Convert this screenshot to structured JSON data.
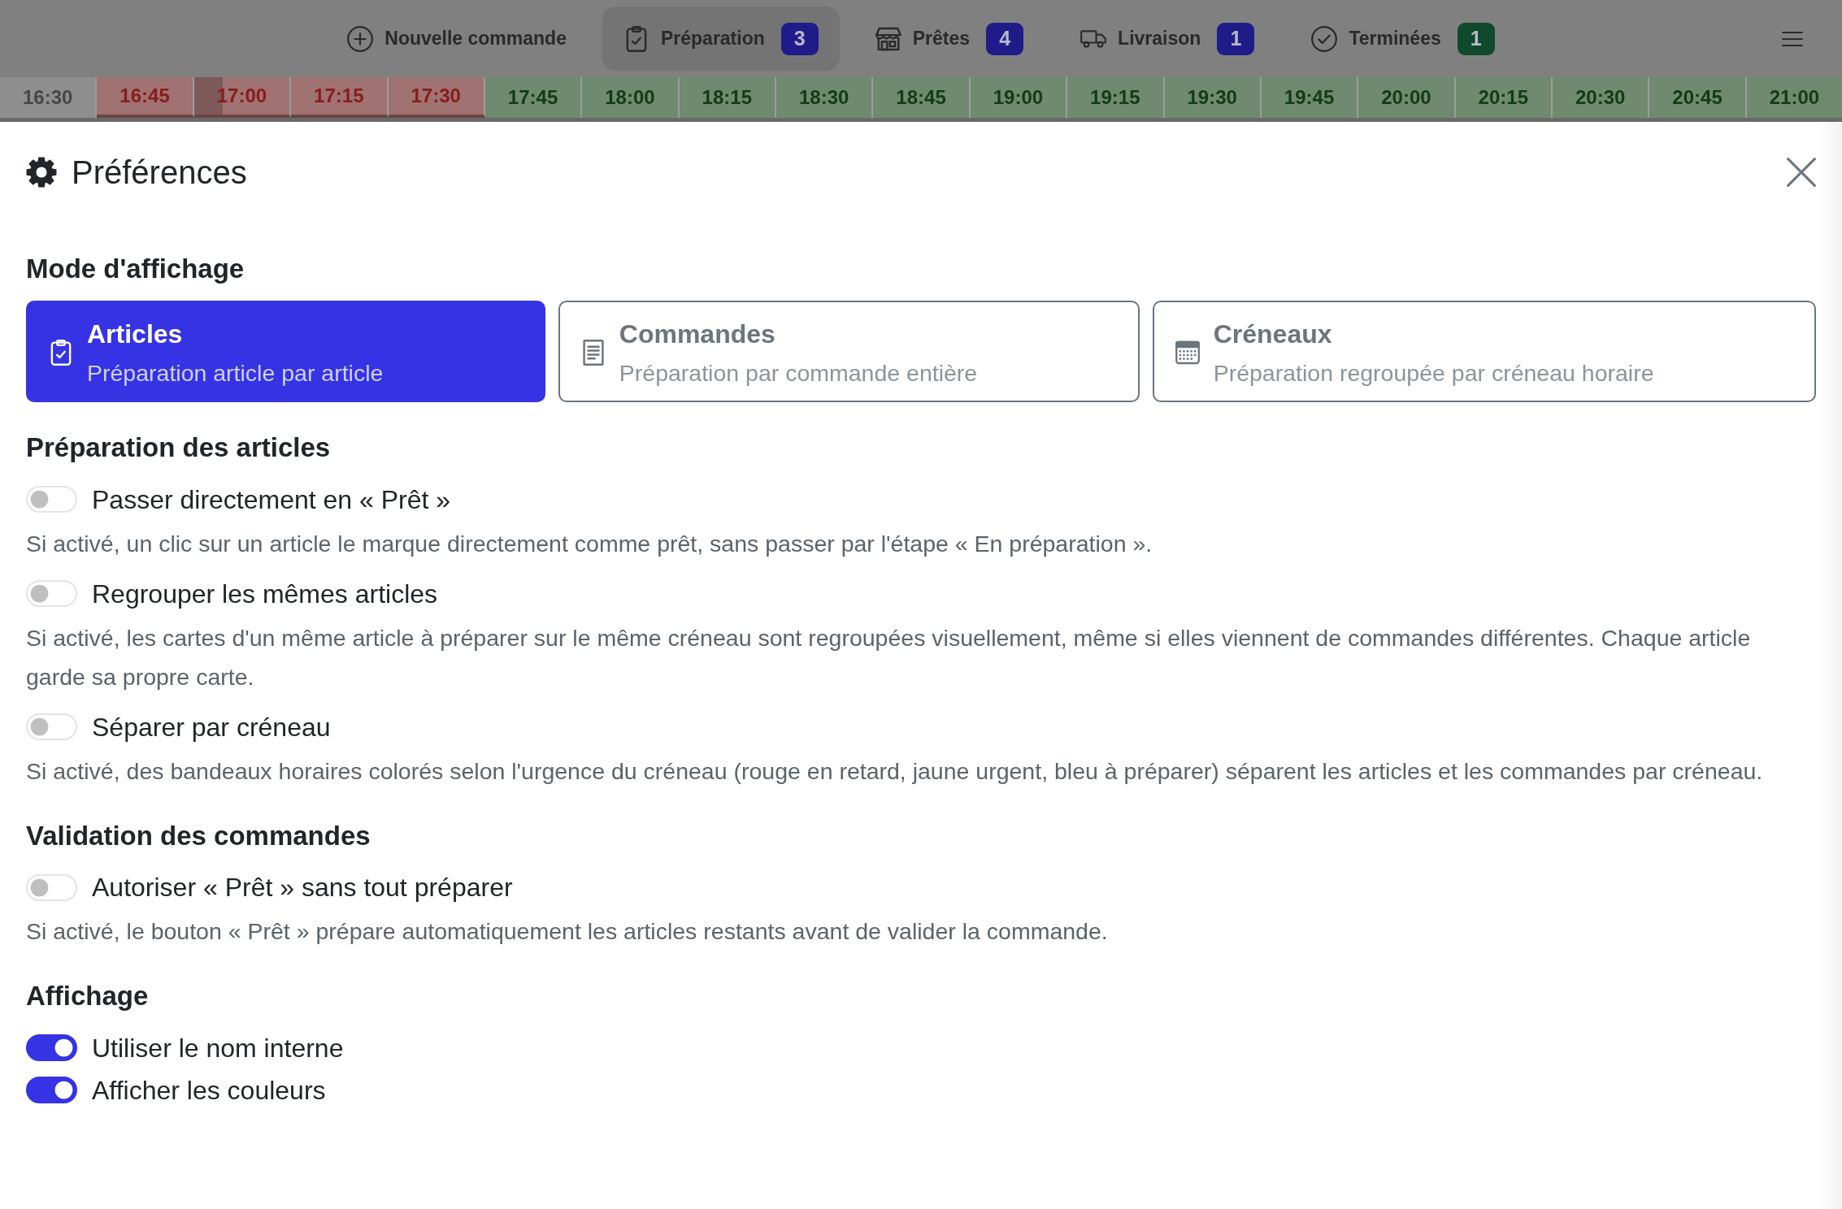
{
  "nav": {
    "items": [
      {
        "label": "Nouvelle commande",
        "selected": false
      },
      {
        "label": "Préparation",
        "badge": "3",
        "color": "#1f1c8a",
        "selected": true
      },
      {
        "label": "Prêtes",
        "badge": "4",
        "color": "#1f1c8a",
        "selected": false
      },
      {
        "label": "Livraison",
        "badge": "1",
        "color": "#1f1c8a",
        "selected": false
      },
      {
        "label": "Terminées",
        "badge": "1",
        "color": "#0e4a2b",
        "selected": false
      }
    ]
  },
  "time_slots": [
    {
      "label": "16:30",
      "kind": "past",
      "current": false
    },
    {
      "label": "16:45",
      "kind": "late",
      "current": false
    },
    {
      "label": "17:00",
      "kind": "late",
      "current": true
    },
    {
      "label": "17:15",
      "kind": "late",
      "current": false
    },
    {
      "label": "17:30",
      "kind": "late",
      "current": false
    },
    {
      "label": "17:45",
      "kind": "upcoming",
      "current": false
    },
    {
      "label": "18:00",
      "kind": "upcoming",
      "current": false
    },
    {
      "label": "18:15",
      "kind": "upcoming",
      "current": false
    },
    {
      "label": "18:30",
      "kind": "upcoming",
      "current": false
    },
    {
      "label": "18:45",
      "kind": "upcoming",
      "current": false
    },
    {
      "label": "19:00",
      "kind": "upcoming",
      "current": false
    },
    {
      "label": "19:15",
      "kind": "upcoming",
      "current": false
    },
    {
      "label": "19:30",
      "kind": "upcoming",
      "current": false
    },
    {
      "label": "19:45",
      "kind": "upcoming",
      "current": false
    },
    {
      "label": "20:00",
      "kind": "upcoming",
      "current": false
    },
    {
      "label": "20:15",
      "kind": "upcoming",
      "current": false
    },
    {
      "label": "20:30",
      "kind": "upcoming",
      "current": false
    },
    {
      "label": "20:45",
      "kind": "upcoming",
      "current": false
    },
    {
      "label": "21:00",
      "kind": "upcoming",
      "current": false
    }
  ],
  "preferences": {
    "title": "Préférences",
    "sections": [
      {
        "heading": "Mode d'affichage",
        "kind": "modes",
        "options": [
          {
            "title": "Articles",
            "description": "Préparation article par article",
            "selected": true
          },
          {
            "title": "Commandes",
            "description": "Préparation par commande entière",
            "selected": false
          },
          {
            "title": "Créneaux",
            "description": "Préparation regroupée par créneau horaire",
            "selected": false
          }
        ]
      },
      {
        "heading": "Préparation des articles",
        "kind": "toggles",
        "settings": [
          {
            "label": "Passer directement en « Prêt »",
            "on": false,
            "description": "Si activé, un clic sur un article le marque directement comme prêt, sans passer par l'étape « En préparation »."
          },
          {
            "label": "Regrouper les mêmes articles",
            "on": false,
            "description": "Si activé, les cartes d'un même article à préparer sur le même créneau sont regroupées visuellement, même si elles viennent de commandes différentes. Chaque article garde sa propre carte."
          },
          {
            "label": "Séparer par créneau",
            "on": false,
            "description": "Si activé, des bandeaux horaires colorés selon l'urgence du créneau (rouge en retard, jaune urgent, bleu à préparer) séparent les articles et les commandes par créneau."
          }
        ]
      },
      {
        "heading": "Validation des commandes",
        "kind": "toggles",
        "settings": [
          {
            "label": "Autoriser « Prêt » sans tout préparer",
            "on": false,
            "description": "Si activé, le bouton « Prêt » prépare automatiquement les articles restants avant de valider la commande."
          }
        ]
      },
      {
        "heading": "Affichage",
        "kind": "toggles",
        "settings": [
          {
            "label": "Utiliser le nom interne",
            "on": true
          },
          {
            "label": "Afficher les couleurs",
            "on": true
          }
        ]
      }
    ]
  }
}
